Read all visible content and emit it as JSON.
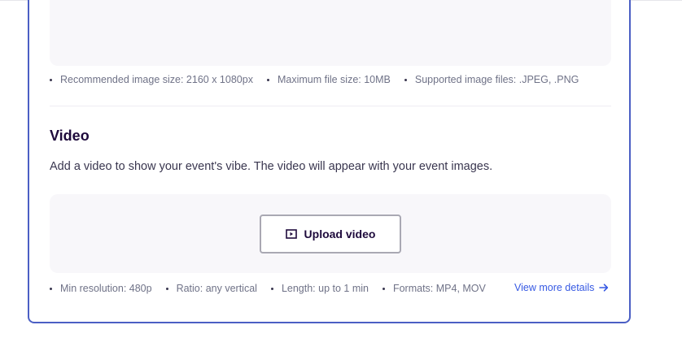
{
  "image_section": {
    "requirements": [
      "Recommended image size: 2160 x 1080px",
      "Maximum file size: 10MB",
      "Supported image files: .JPEG, .PNG"
    ]
  },
  "video_section": {
    "title": "Video",
    "description": "Add a video to show your event's vibe. The video will appear with your event images.",
    "upload_button_label": "Upload video",
    "upload_icon": "video-upload-icon",
    "requirements": [
      "Min resolution: 480p",
      "Ratio: any vertical",
      "Length: up to 1 min",
      "Formats: MP4, MOV"
    ],
    "more_details_label": "View more details",
    "more_details_icon": "arrow-right-icon"
  },
  "colors": {
    "card_border": "#4b5fc4",
    "link": "#3659e3",
    "dropzone_bg": "#f8f7fa",
    "heading": "#1e0a3c"
  }
}
